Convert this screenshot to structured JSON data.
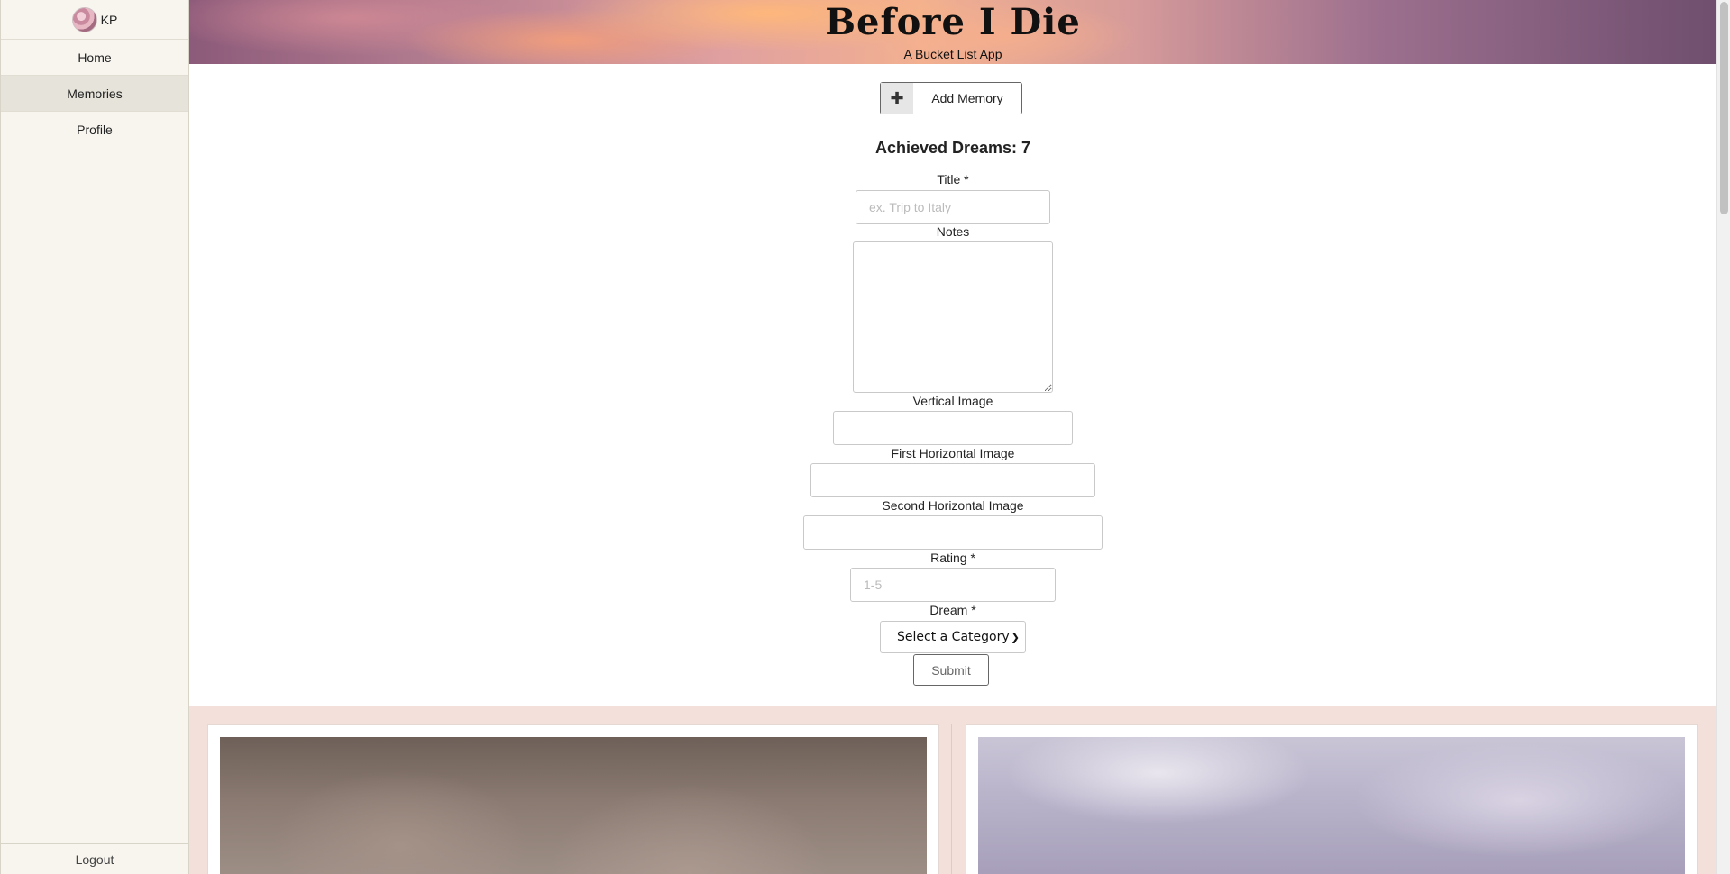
{
  "sidebar": {
    "user_initials": "KP",
    "nav": [
      {
        "label": "Home"
      },
      {
        "label": "Memories",
        "active": true
      },
      {
        "label": "Profile"
      }
    ],
    "logout_label": "Logout"
  },
  "header": {
    "title": "Before I Die",
    "subtitle": "A Bucket List App"
  },
  "form": {
    "add_button_label": "Add Memory",
    "achieved_text": "Achieved Dreams: 7",
    "title_label": "Title *",
    "title_placeholder": "ex. Trip to Italy",
    "notes_label": "Notes",
    "vertical_image_label": "Vertical Image",
    "first_horizontal_label": "First Horizontal Image",
    "second_horizontal_label": "Second Horizontal Image",
    "rating_label": "Rating *",
    "rating_placeholder": "1-5",
    "dream_label": "Dream *",
    "dream_select_value": "Select a Category",
    "submit_label": "Submit"
  },
  "icons": {
    "plus": "plus-icon",
    "chevron": "chevron-down-icon"
  },
  "colors": {
    "sidebar_bg": "#f8f5ef",
    "active_nav_bg": "#e6e3da",
    "cards_bg": "#f4e0da"
  }
}
